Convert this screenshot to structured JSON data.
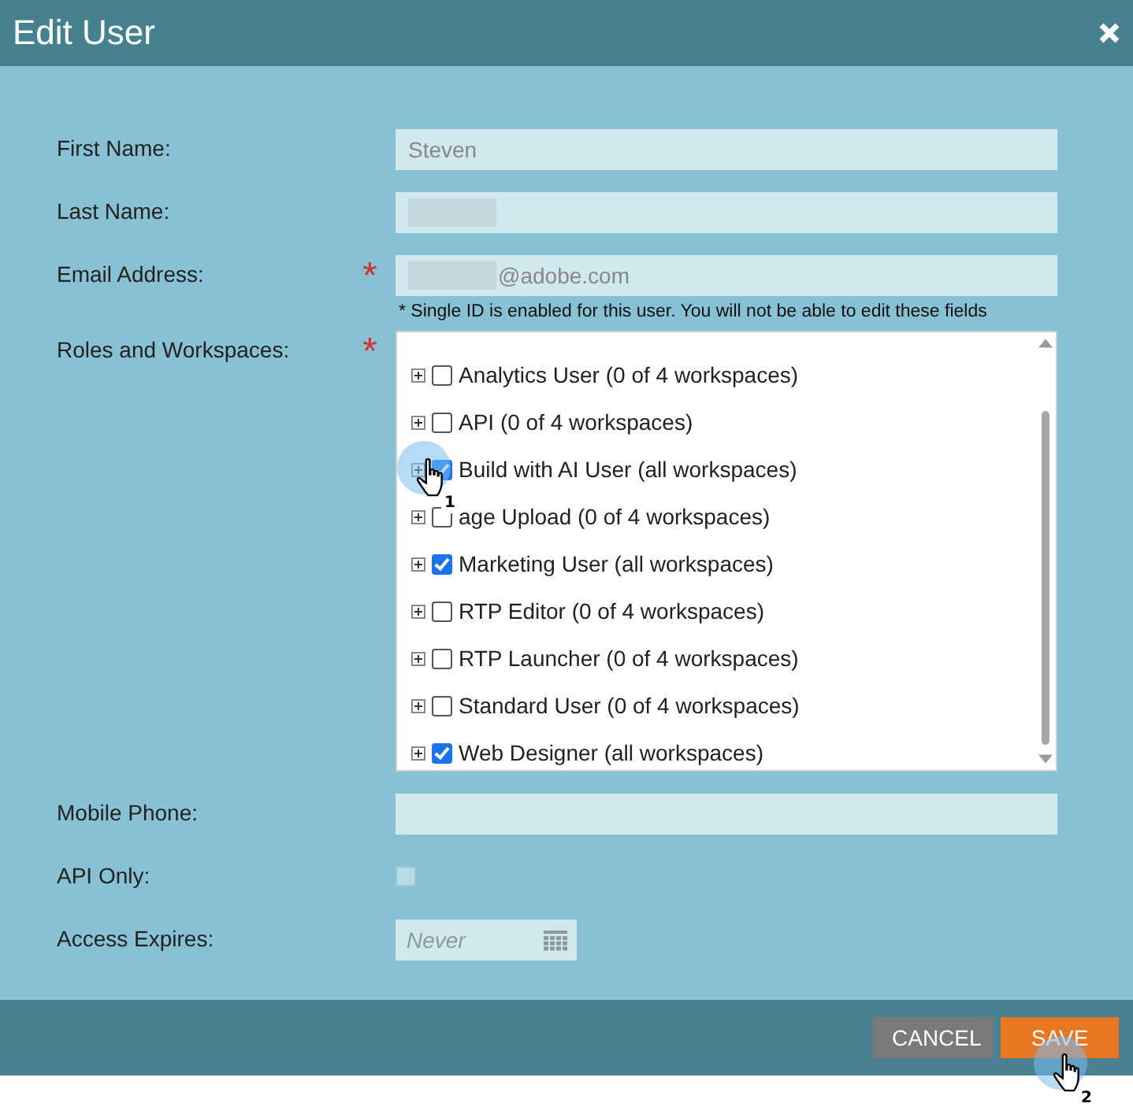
{
  "window": {
    "title": "Edit User"
  },
  "fields": [
    {
      "label": "First Name:",
      "value": "Steven",
      "redacted": false
    },
    {
      "label": "Last Name:",
      "redacted": true
    },
    {
      "label": "Email Address:",
      "required_mark": "*",
      "value": "@adobe.com",
      "redacted": true
    }
  ],
  "note": "* Single ID is enabled for this user. You will not be able to edit these fields",
  "roles": {
    "label": "Roles and Workspaces:",
    "required_mark": "*",
    "items": [
      {
        "label": "Analytics User (0 of 4 workspaces)",
        "checked": false
      },
      {
        "label": "API (0 of 4 workspaces)",
        "checked": false
      },
      {
        "label": "Build with AI User (all workspaces)",
        "checked": true
      },
      {
        "label": "age Upload (0 of 4 workspaces)",
        "checked": false
      },
      {
        "label": "Marketing User (all workspaces)",
        "checked": true
      },
      {
        "label": "RTP Editor (0 of 4 workspaces)",
        "checked": false
      },
      {
        "label": "RTP Launcher (0 of 4 workspaces)",
        "checked": false
      },
      {
        "label": "Standard User (0 of 4 workspaces)",
        "checked": false
      },
      {
        "label": "Web Designer (all workspaces)",
        "checked": true
      }
    ]
  },
  "mobile": {
    "label": "Mobile Phone:"
  },
  "api_only": {
    "label": "API Only:",
    "checked": false
  },
  "expires": {
    "label": "Access Expires:",
    "placeholder": "Never"
  },
  "buttons": [
    {
      "label": "CANCEL",
      "kind": "secondary"
    },
    {
      "label": "SAVE",
      "kind": "primary"
    }
  ],
  "callouts": [
    {
      "number": "1"
    },
    {
      "number": "2"
    }
  ]
}
